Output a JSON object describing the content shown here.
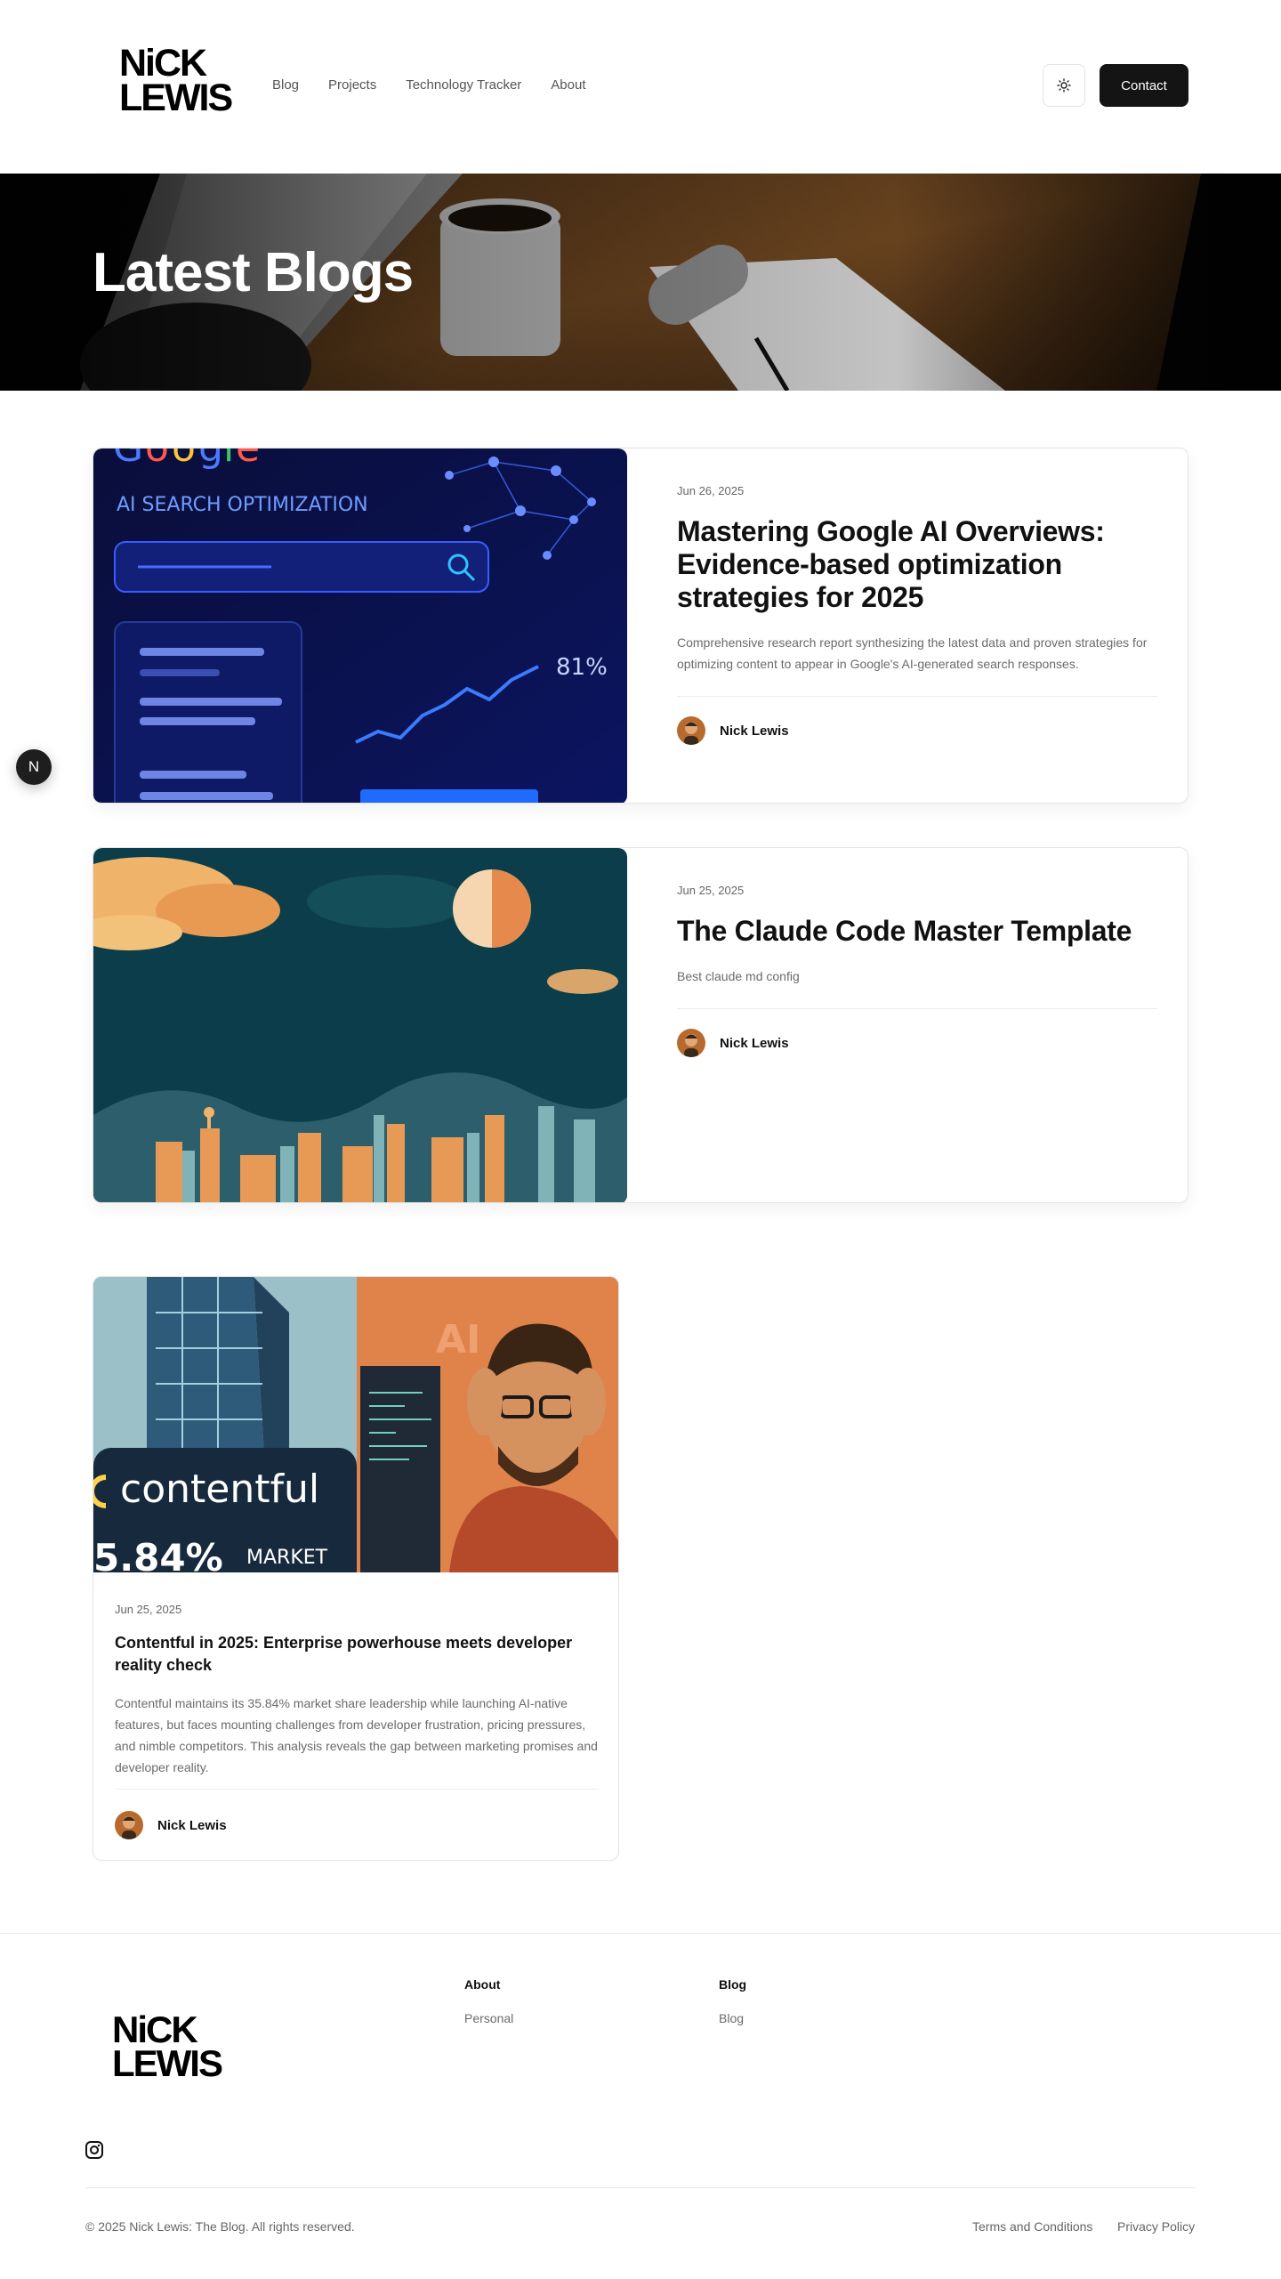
{
  "brand": {
    "logo_line1": "NiCK",
    "logo_line2": "LEWIS"
  },
  "nav": {
    "items": [
      "Blog",
      "Projects",
      "Technology Tracker",
      "About"
    ]
  },
  "header": {
    "theme_toggle_icon": "sun-icon",
    "contact_label": "Contact"
  },
  "hero": {
    "title": "Latest Blogs"
  },
  "posts": [
    {
      "date": "Jun 26, 2025",
      "title": "Mastering Google AI Overviews: Evidence-based optimization strategies for 2025",
      "excerpt": "Comprehensive research report synthesizing the latest data and proven strategies for optimizing content to appear in Google's AI-generated search responses.",
      "author": "Nick Lewis",
      "image_text": {
        "heading": "AI SEARCH OPTIMIZATION",
        "stat": "81%"
      }
    },
    {
      "date": "Jun 25, 2025",
      "title": "The Claude Code Master Template",
      "excerpt": "Best claude md config",
      "author": "Nick Lewis"
    },
    {
      "date": "Jun 25, 2025",
      "title": "Contentful in 2025: Enterprise powerhouse meets developer reality check",
      "excerpt": "Contentful maintains its 35.84% market share leadership while launching AI-native features, but faces mounting challenges from developer frustration, pricing pressures, and nimble competitors. This analysis reveals the gap between marketing promises and developer reality.",
      "author": "Nick Lewis",
      "image_text": {
        "brand": "contentful",
        "stat": "5.84%",
        "stat_label": "MARKET",
        "badge": "AI"
      }
    }
  ],
  "floating_badge": {
    "label": "N"
  },
  "footer": {
    "columns": [
      {
        "title": "About",
        "links": [
          "Personal"
        ]
      },
      {
        "title": "Blog",
        "links": [
          "Blog"
        ]
      }
    ],
    "social_icon": "instagram-icon",
    "copyright": "© 2025 Nick Lewis: The Blog. All rights reserved.",
    "legal": [
      "Terms and Conditions",
      "Privacy Policy"
    ]
  },
  "colors": {
    "primary_button": "#141414",
    "text": "#111111",
    "muted": "#6b6b6b",
    "border": "#e4e4e4"
  }
}
